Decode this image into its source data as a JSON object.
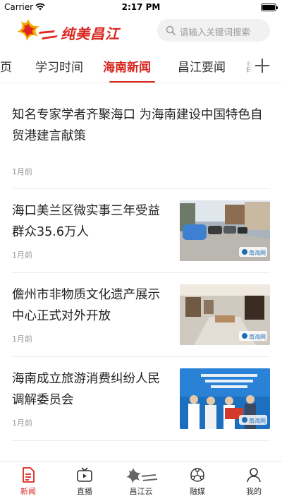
{
  "status_bar": {
    "carrier": "Carrier",
    "time": "2:17 PM"
  },
  "header": {
    "logo_text": "纯美昌江",
    "search_placeholder": "请输入关键词搜索"
  },
  "tabs": [
    {
      "label": "首页"
    },
    {
      "label": "学习时间"
    },
    {
      "label": "海南新闻"
    },
    {
      "label": "昌江要闻"
    },
    {
      "label": "昌"
    }
  ],
  "active_tab": "海南新闻",
  "news": [
    {
      "title": "知名专家学者齐聚海口 为海南建设中国特色自贸港建言献策",
      "time": "1月前"
    },
    {
      "title": "海口美兰区微实事三年受益群众35.6万人",
      "time": "1月前",
      "watermark": "南海网"
    },
    {
      "title": "儋州市非物质文化遗产展示中心正式对外开放",
      "time": "1月前",
      "watermark": "南海网"
    },
    {
      "title": "海南成立旅游消费纠纷人民调解委员会",
      "time": "1月前",
      "watermark": "南海网"
    }
  ],
  "bottom_nav": [
    {
      "label": "新闻",
      "icon": "news-icon",
      "active": true
    },
    {
      "label": "直播",
      "icon": "tv-icon",
      "active": false
    },
    {
      "label": "昌江云",
      "icon": "changjiang-cloud-logo",
      "active": false
    },
    {
      "label": "融媒",
      "icon": "media-hub-icon",
      "active": false
    },
    {
      "label": "我的",
      "icon": "profile-icon",
      "active": false
    }
  ],
  "colors": {
    "accent": "#d8261f",
    "muted": "#999999",
    "search_bg": "#f1f1f1"
  }
}
